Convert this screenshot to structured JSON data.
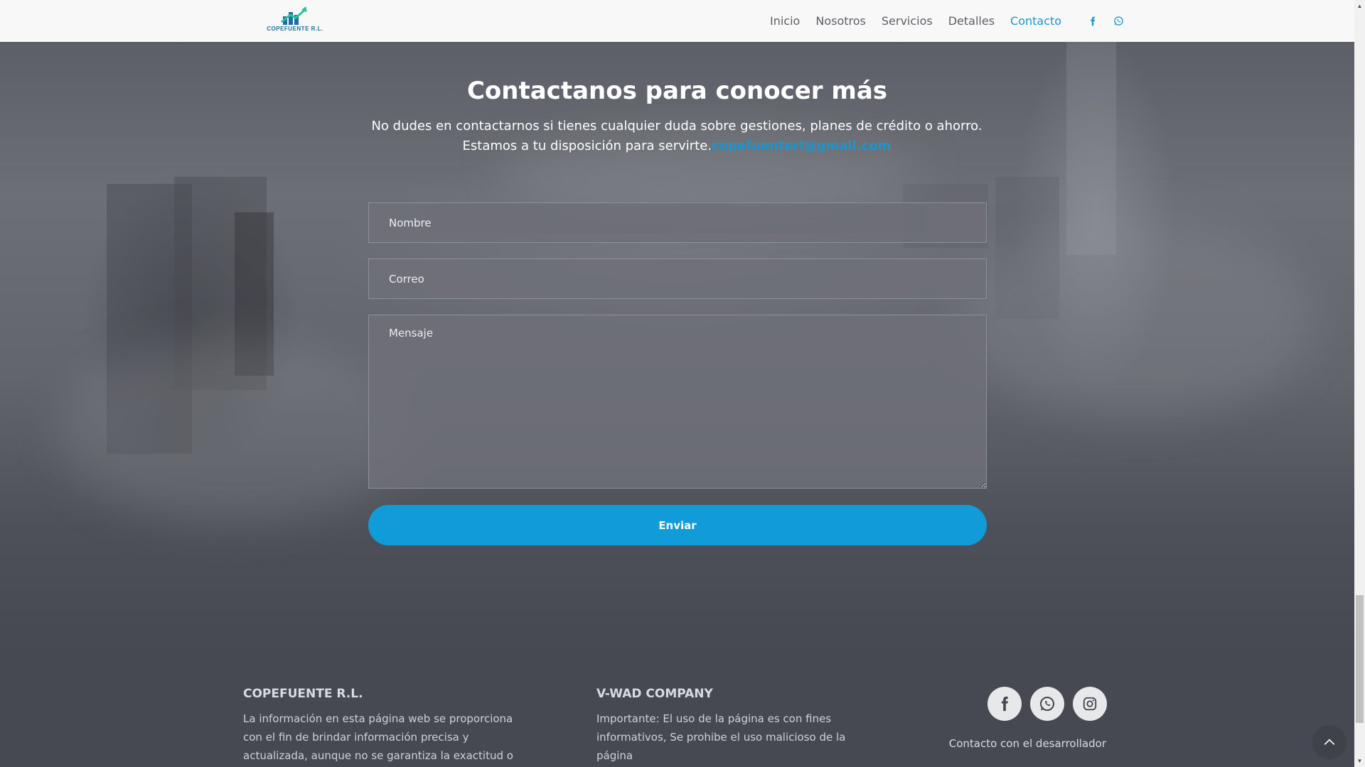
{
  "header": {
    "logo_text": "COPEFUENTE R.L.",
    "nav": [
      {
        "label": "Inicio",
        "active": false
      },
      {
        "label": "Nosotros",
        "active": false
      },
      {
        "label": "Servicios",
        "active": false
      },
      {
        "label": "Detalles",
        "active": false
      },
      {
        "label": "Contacto",
        "active": true
      }
    ],
    "icons": [
      "facebook-icon",
      "whatsapp-icon"
    ],
    "accent_color": "#1b96cc"
  },
  "contact": {
    "title": "Contactanos para conocer más",
    "subtitle_line1": "No dudes en contactarnos si tienes cualquier duda sobre gestiones, planes de crédito o ahorro.",
    "subtitle_line2": "Estamos a tu disposición para servirte.",
    "email": "copefuenterl@gmail.com",
    "fields": {
      "name_placeholder": "Nombre",
      "email_placeholder": "Correo",
      "message_placeholder": "Mensaje"
    },
    "submit_label": "Enviar",
    "button_color": "#129bd9"
  },
  "footer": {
    "col1": {
      "title": "COPEFUENTE R.L.",
      "text": "La información en esta página web se proporciona con el fin de brindar información precisa y actualizada, aunque no se garantiza la exactitud o"
    },
    "col2": {
      "title": "V-WAD COMPANY",
      "text": "Importante: El uso de la página es con fines informativos, Se prohibe el uso malicioso de la página"
    },
    "social_icons": [
      "facebook-icon",
      "whatsapp-icon",
      "instagram-icon"
    ],
    "developer_link": "Contacto con el desarrollador"
  }
}
